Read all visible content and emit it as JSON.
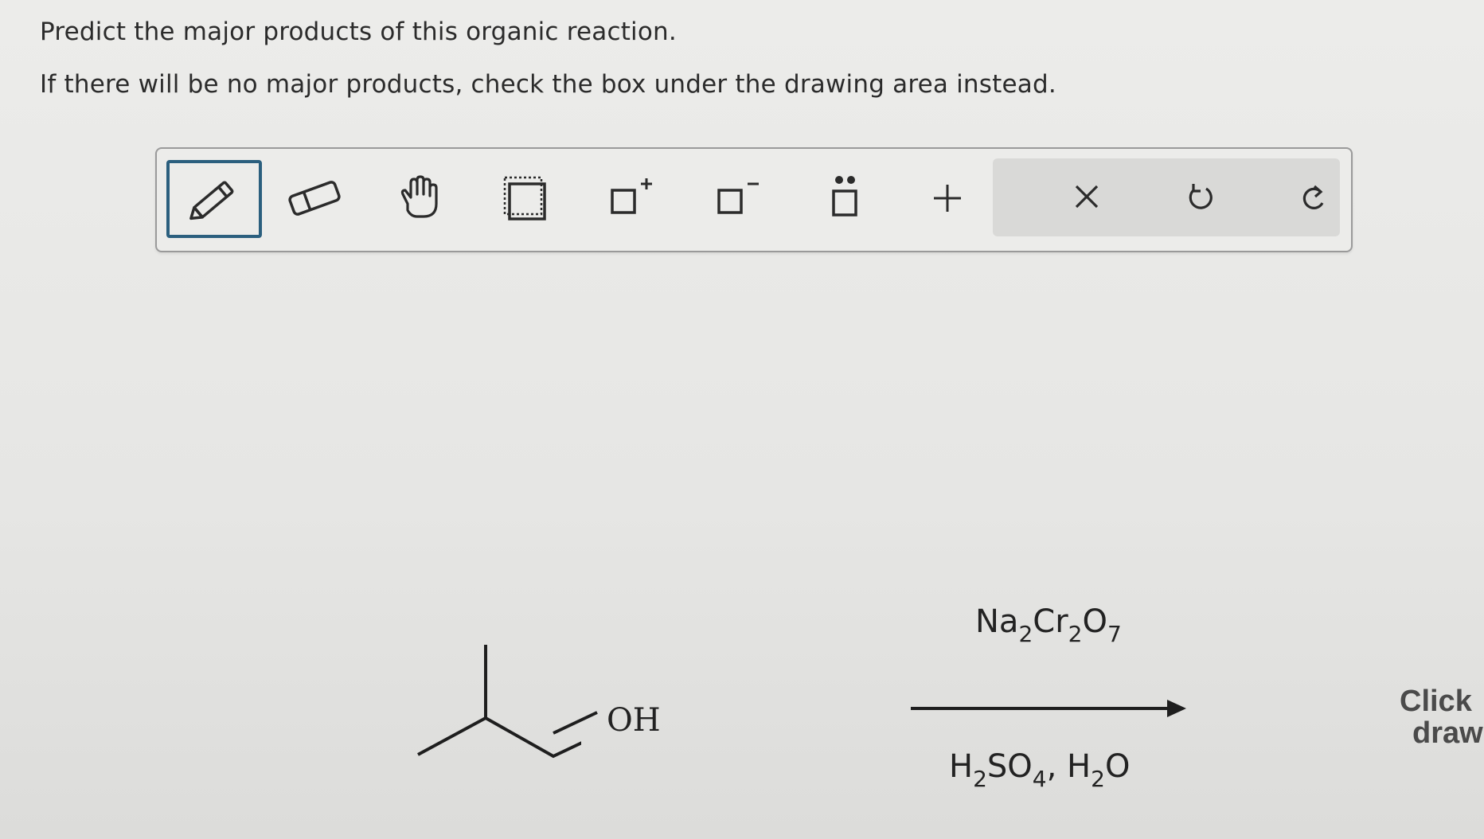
{
  "prompt": {
    "line1": "Predict the major products of this organic reaction.",
    "line2": "If there will be no major products, check the box under the drawing area instead."
  },
  "toolbar": {
    "tools": [
      {
        "name": "pencil-icon",
        "label": "Draw",
        "active": true
      },
      {
        "name": "eraser-icon",
        "label": "Erase"
      },
      {
        "name": "hand-icon",
        "label": "Move"
      },
      {
        "name": "selection-box-icon",
        "label": "Select"
      },
      {
        "name": "positive-charge-icon",
        "label": "+"
      },
      {
        "name": "negative-charge-icon",
        "label": "−"
      },
      {
        "name": "lone-pair-icon",
        "label": "Lone pair"
      },
      {
        "name": "add-icon",
        "label": "+"
      },
      {
        "name": "close-icon",
        "label": "×"
      },
      {
        "name": "undo-icon",
        "label": "Undo"
      },
      {
        "name": "redo-icon",
        "label": "Redo"
      }
    ],
    "accent": "#2b5f7e"
  },
  "reaction": {
    "reactant_label": "OH",
    "reagent_top": {
      "a": "Na",
      "a_sub": "2",
      "b": "Cr",
      "b_sub": "2",
      "c": "O",
      "c_sub": "7"
    },
    "reagent_bottom": {
      "a": "H",
      "a_sub": "2",
      "b": "SO",
      "b_sub": "4",
      "sep": ",",
      "c": "H",
      "c_sub": "2",
      "d": "O"
    }
  },
  "side_hint": {
    "line1": "Click",
    "line2": "draw"
  }
}
